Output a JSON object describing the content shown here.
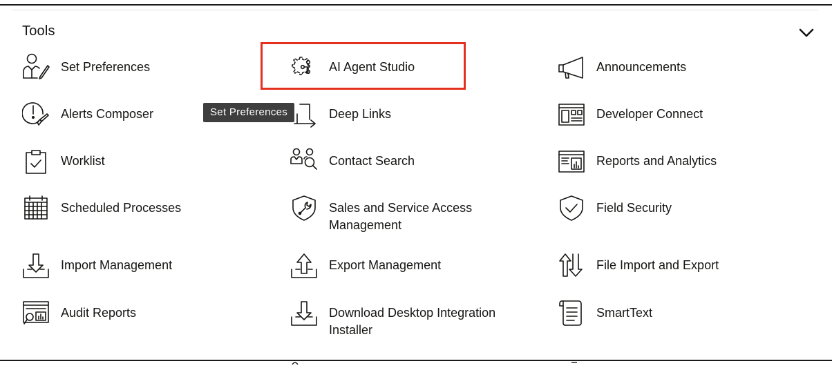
{
  "section": {
    "title": "Tools"
  },
  "tooltip": {
    "text": "Set Preferences"
  },
  "colors": {
    "highlight": "#e5301f",
    "tooltip_bg": "#3e3e3e",
    "text": "#161513"
  },
  "items": [
    {
      "label": "Set Preferences",
      "icon": "person-pencil-icon"
    },
    {
      "label": "AI Agent Studio",
      "icon": "ai-gear-icon"
    },
    {
      "label": "Announcements",
      "icon": "megaphone-icon"
    },
    {
      "label": "Alerts Composer",
      "icon": "alert-wrench-icon"
    },
    {
      "label": "Deep Links",
      "icon": "link-arrow-icon"
    },
    {
      "label": "Developer Connect",
      "icon": "developer-panel-icon"
    },
    {
      "label": "Worklist",
      "icon": "clipboard-check-icon"
    },
    {
      "label": "Contact Search",
      "icon": "people-search-icon"
    },
    {
      "label": "Reports and Analytics",
      "icon": "report-chart-icon"
    },
    {
      "label": "Scheduled Processes",
      "icon": "calendar-icon"
    },
    {
      "label": "Sales and Service Access Management",
      "icon": "shield-wrench-icon"
    },
    {
      "label": "Field Security",
      "icon": "shield-check-icon"
    },
    {
      "label": "Import Management",
      "icon": "import-tray-icon"
    },
    {
      "label": "Export Management",
      "icon": "export-tray-icon"
    },
    {
      "label": "File Import and Export",
      "icon": "up-down-arrows-icon"
    },
    {
      "label": "Audit Reports",
      "icon": "audit-report-icon"
    },
    {
      "label": "Download Desktop Integration Installer",
      "icon": "download-tray-icon"
    },
    {
      "label": "SmartText",
      "icon": "scroll-document-icon"
    }
  ]
}
